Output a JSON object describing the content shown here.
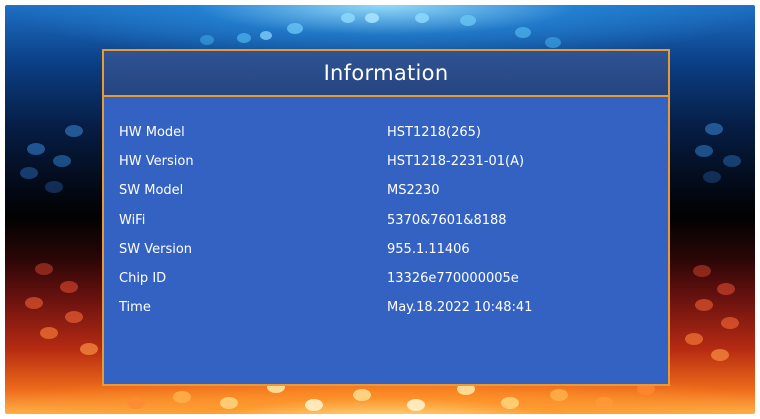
{
  "dialog": {
    "title": "Information",
    "rows": [
      {
        "label": "HW Model",
        "value": "HST1218(265)"
      },
      {
        "label": "HW Version",
        "value": "HST1218-2231-01(A)"
      },
      {
        "label": "SW Model",
        "value": "MS2230"
      },
      {
        "label": "WiFi",
        "value": "5370&7601&8188"
      },
      {
        "label": "SW Version",
        "value": "955.1.11406"
      },
      {
        "label": "Chip ID",
        "value": "13326e770000005e"
      },
      {
        "label": "Time",
        "value": "May.18.2022 10:48:41"
      }
    ]
  },
  "colors": {
    "panel_background": "#3462c2",
    "header_background": "#2a4a88",
    "border": "#e99a37",
    "text": "#ffffff"
  }
}
